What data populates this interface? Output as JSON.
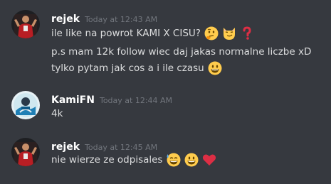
{
  "messages": [
    {
      "username": "rejek",
      "timestamp": "Today at 12:43 AM",
      "lines": [
        "ile like na powrot KAMI X CISU?",
        "p.s mam 12k follow wiec daj jakas normalne liczbe xD",
        "tylko pytam jak cos a i ile czasu"
      ]
    },
    {
      "username": "KamiFN",
      "timestamp": "Today at 12:44 AM",
      "lines": [
        "4k"
      ]
    },
    {
      "username": "rejek",
      "timestamp": "Today at 12:45 AM",
      "lines": [
        "nie wierze ze odpisales"
      ]
    }
  ],
  "emojis": {
    "thinking": "thinking-face",
    "smirk_cat": "smirking-cat-face",
    "question": "red-question-mark",
    "grin": "grinning-face",
    "sweat_smile": "grinning-face-with-sweat",
    "heart": "red-heart"
  },
  "colors": {
    "background": "#36393f",
    "username": "#ffffff",
    "timestamp": "#72767d",
    "text": "#dcddde"
  }
}
